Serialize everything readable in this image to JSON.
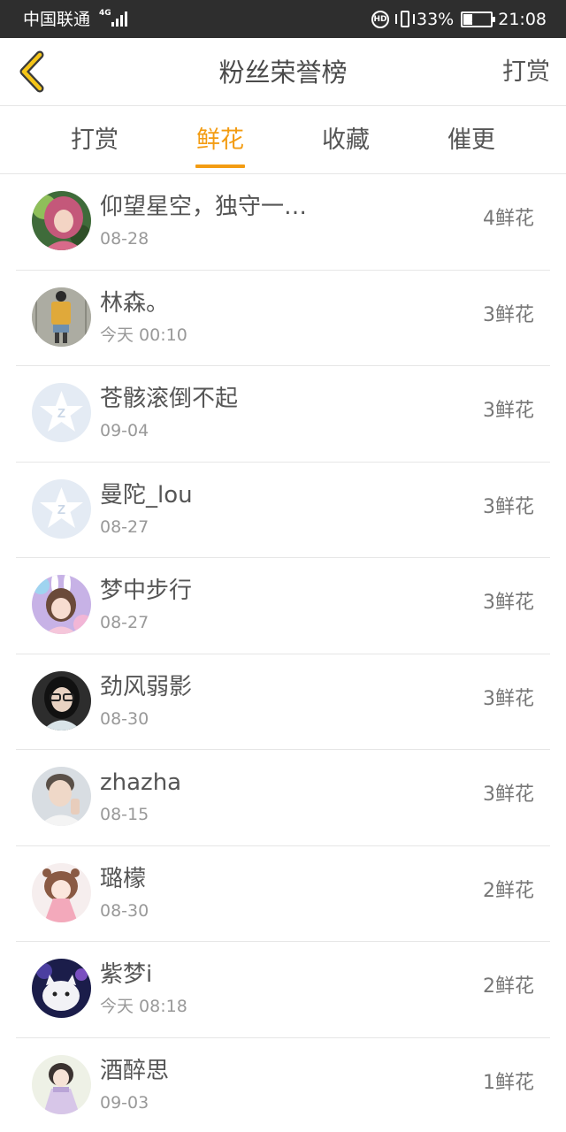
{
  "status_bar": {
    "carrier": "中国联通",
    "network": "4G",
    "volte": "HD",
    "battery_percent": "33%",
    "battery_level": 0.33,
    "time": "21:08"
  },
  "header": {
    "back_icon": "chevron-left-icon",
    "title": "粉丝荣誉榜",
    "action_label": "打赏",
    "accent_color": "#f39c12"
  },
  "tabs": [
    {
      "label": "打赏",
      "active": false
    },
    {
      "label": "鲜花",
      "active": true
    },
    {
      "label": "收藏",
      "active": false
    },
    {
      "label": "催更",
      "active": false
    }
  ],
  "list": [
    {
      "name": "仰望星空，独守一…",
      "date": "08-28",
      "amount": "4鲜花",
      "avatar": "photo-avatar"
    },
    {
      "name": "林森。",
      "date": "今天 00:10",
      "amount": "3鲜花",
      "avatar": "photo-avatar"
    },
    {
      "name": "苍骸滚倒不起",
      "date": "09-04",
      "amount": "3鲜花",
      "avatar": "default-star-avatar"
    },
    {
      "name": "曼陀_lou",
      "date": "08-27",
      "amount": "3鲜花",
      "avatar": "default-star-avatar"
    },
    {
      "name": "梦中步行",
      "date": "08-27",
      "amount": "3鲜花",
      "avatar": "photo-avatar"
    },
    {
      "name": "劲风弱影",
      "date": "08-30",
      "amount": "3鲜花",
      "avatar": "photo-avatar"
    },
    {
      "name": "zhazha",
      "date": "08-15",
      "amount": "3鲜花",
      "avatar": "photo-avatar"
    },
    {
      "name": "璐檬",
      "date": "08-30",
      "amount": "2鲜花",
      "avatar": "photo-avatar"
    },
    {
      "name": "紫梦i",
      "date": "今天 08:18",
      "amount": "2鲜花",
      "avatar": "photo-avatar"
    },
    {
      "name": "酒醉思",
      "date": "09-03",
      "amount": "1鲜花",
      "avatar": "photo-avatar"
    }
  ]
}
